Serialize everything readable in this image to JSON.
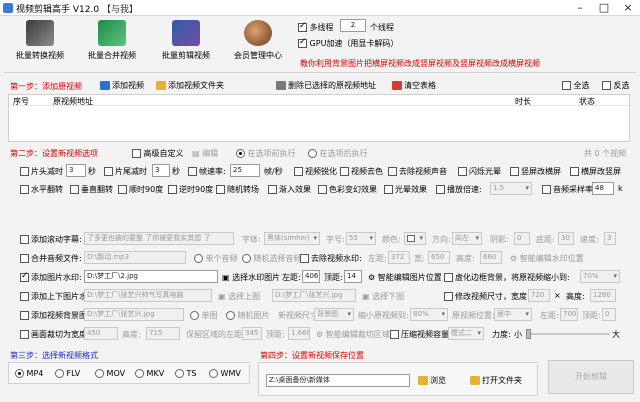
{
  "window": {
    "title": "视频剪辑高手 V12.0",
    "tag": "【与我】"
  },
  "top_buttons": [
    {
      "label": "批量转换视频"
    },
    {
      "label": "批量合并视频"
    },
    {
      "label": "批量剪辑视频"
    },
    {
      "label": "会员管理中心"
    }
  ],
  "threads": {
    "label": "多线程",
    "value": "2",
    "unit": "个线程",
    "gpu_label": "GPU加速（用显卡解码）"
  },
  "tip": "教你利用背景图片把横屏视频改成竖屏视频及竖屏视频改成横屏视频",
  "step1": {
    "title": "第一步：添加原视频",
    "add_video": "添加视频",
    "add_folder": "添加视频文件夹",
    "delete": "删除已选择的原视频地址",
    "clear": "清空表格",
    "select_all": "全选",
    "invert": "反选"
  },
  "table": {
    "col_index": "序号",
    "col_path": "原视频地址",
    "col_duration": "时长",
    "col_status": "状态"
  },
  "step2": {
    "title": "第二步：设置新视频选项",
    "advanced": "高级自定义",
    "edit": "编辑",
    "before": "在选项前执行",
    "after": "在选项后执行",
    "count": "共 0 个视频"
  },
  "r1": {
    "head_cut": "片头减时",
    "head_val": "3",
    "tail_cut": "片尾减时",
    "tail_val": "3",
    "sec": "秒",
    "framerate": "帧速率:",
    "framerate_val": "25",
    "fps": "帧/秒",
    "sharpen": "视频锐化",
    "decolor": "视频去色",
    "remove_audio": "去除视频声音",
    "flash": "闪烁光晕",
    "vert": "竖屏改横屏",
    "horiz": "横屏改竖屏"
  },
  "r2": {
    "hflip": "水平翻转",
    "vflip": "垂直翻转",
    "cw90": "顺时90度",
    "ccw90": "逆时90度",
    "rand_trans": "随机转场",
    "fade": "渐入效果",
    "color_fx": "色彩变幻效果",
    "light_fx": "光晕效果",
    "speed": "播放倍速:",
    "speed_val": "1.5",
    "sample": "音频采样率:",
    "sample_val": "48",
    "khz": "k"
  },
  "r3": {
    "label": "添加滚动字幕:",
    "text": "了多更也被的要整 了你被更我实其想 了",
    "font_label": "字体:",
    "font_val": "黑体(simhei)",
    "size_label": "字号:",
    "size_val": "55",
    "color_label": "颜色:",
    "dir_label": "方向:",
    "dir_val": "向左",
    "shadow_label": "阴影:",
    "shadow_val": "0",
    "bottom_label": "底距:",
    "bottom_val": "30",
    "speed_label": "速度:",
    "speed_val": "3"
  },
  "r4": {
    "label": "合并音频文件:",
    "path": "D:\\飘动.mp3",
    "single": "单个音频",
    "random": "随机选择音频",
    "logo": "去除视频水印:",
    "left_label": "左距:",
    "left_val": "372",
    "w_label": "宽:",
    "w_val": "650",
    "h_label": "高度:",
    "h_val": "660",
    "smart": "智能编辑水印位置"
  },
  "r5": {
    "label": "添加图片水印:",
    "path": "D:\\梦工厂\\2.jpg",
    "choose": "选择水印图片",
    "left_label": "左距:",
    "left_val": "406",
    "top_label": "顶距:",
    "top_val": "14",
    "smart": "智能编辑图片位置",
    "virtual": "虚化边框背景，将原视频缩小到:",
    "virtual_val": "70%"
  },
  "r6": {
    "label": "添加上下图片水印:",
    "top_path": "D:\\梦工厂\\张艺兴帅气写真电脑",
    "choose_top": "选择上图",
    "bottom_path": "D:\\梦工厂\\张艺兴.jpg",
    "choose_bottom": "选择下图",
    "resize": "修改视频尺寸，宽度:",
    "w_val": "720",
    "x": "×",
    "h_label": "高度:",
    "h_val": "1280"
  },
  "r7": {
    "label": "添加视频背景图片:",
    "path": "D:\\梦工厂\\张艺兴.jpg",
    "single": "单图",
    "random": "随机图片",
    "size_label": "新视频尺寸:",
    "size_val": "背景图",
    "shrink": "缩小原视频到:",
    "shrink_val": "80%",
    "pos_label": "原视频位置:",
    "pos_val": "居中",
    "left_label": "左距:",
    "left_val": "700",
    "top_label": "顶距:",
    "top_val": "0"
  },
  "r8": {
    "label": "画面裁切为宽度:",
    "w_val": "450",
    "h_label": "高度:",
    "h_val": "715",
    "keep_label": "保留区域的左距:",
    "left_val": "345",
    "top_label": "顶距:",
    "top_val": "1.666",
    "smart": "智能编辑裁切区域",
    "compress": "压缩视频容量",
    "mode_val": "模式二",
    "strength": "力度:",
    "small": "小",
    "big": "大"
  },
  "step3": {
    "title": "第三步：选择新视频格式",
    "formats": [
      "MP4",
      "FLV",
      "MOV",
      "MKV",
      "TS",
      "WMV"
    ]
  },
  "step4": {
    "title": "第四步：设置新视频保存位置",
    "path": "Z:\\桌面备份\\新媒体",
    "browse": "浏览",
    "open": "打开文件夹",
    "start": "开始剪辑"
  },
  "colors": {
    "accent_red": "#d40000",
    "tip_red": "#d40000",
    "step_blue": "#1a28c8"
  }
}
